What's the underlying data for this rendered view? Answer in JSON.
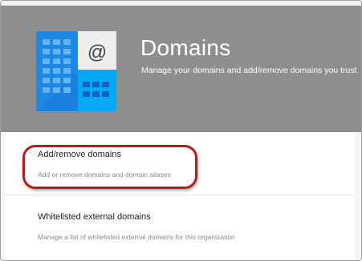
{
  "header": {
    "title": "Domains",
    "subtitle": "Manage your domains and add/remove domains you trust",
    "icon": "domains-building-icon",
    "background_color": "#8e8e8e"
  },
  "settings": [
    {
      "title": "Add/remove domains",
      "description": "Add or remove domains and domain aliases"
    },
    {
      "title": "Whitelisted external domains",
      "description": "Manage a list of whitelisted external domains for this organization"
    }
  ],
  "annotation": {
    "type": "highlight-oval",
    "target": "add-remove-domains",
    "color": "#b71c1c"
  }
}
